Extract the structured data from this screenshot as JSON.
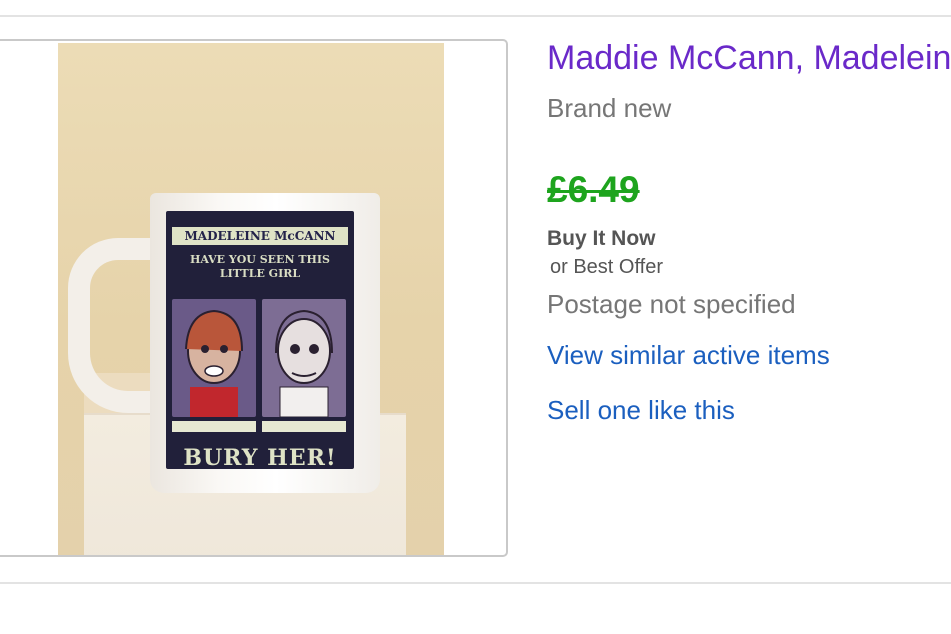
{
  "listing": {
    "title": "Maddie McCann, Madeleine",
    "condition": "Brand new",
    "price": "£6.49",
    "format": "Buy It Now",
    "offer": "or Best Offer",
    "postage": "Postage not specified",
    "links": {
      "view_similar": "View similar active items",
      "sell_one": "Sell one like this"
    }
  },
  "image": {
    "decal_title": "MADELEINE McCANN",
    "decal_line1": "HAVE YOU SEEN THIS",
    "decal_line2": "LITTLE GIRL",
    "decal_bottom": "BURY HER!"
  },
  "colors": {
    "title_link": "#6a29c9",
    "price": "#1ea41e",
    "link": "#1b5fbf",
    "muted_text": "#767676"
  }
}
